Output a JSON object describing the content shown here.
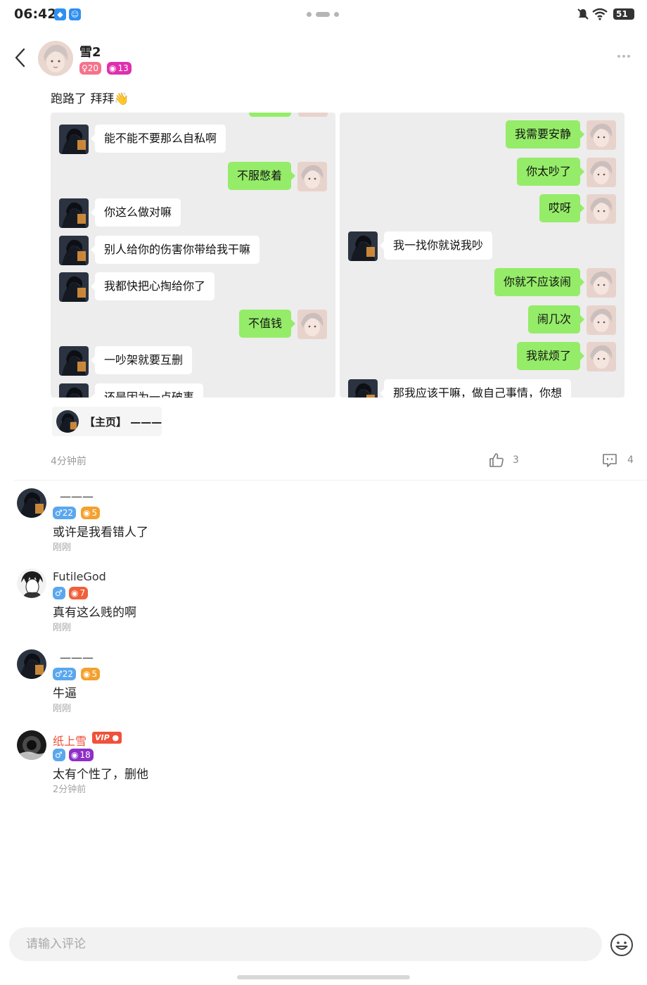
{
  "status_bar": {
    "time": "06:42",
    "battery": "51"
  },
  "header": {
    "user_name": "雪2",
    "gender_age_badge": "♀20",
    "level_badge": "13"
  },
  "post": {
    "text": "跑路了 拜拜👋",
    "left_screenshot": [
      {
        "side": "left",
        "text": "能不能不要那么自私啊"
      },
      {
        "side": "right",
        "text": "不服憋着"
      },
      {
        "side": "left",
        "text": "你这么做对嘛"
      },
      {
        "side": "left",
        "text": "别人给你的伤害你带给我干嘛"
      },
      {
        "side": "left",
        "text": "我都快把心掏给你了"
      },
      {
        "side": "right",
        "text": "不值钱"
      },
      {
        "side": "left",
        "text": "一吵架就要互删"
      },
      {
        "side": "left",
        "text": "还是因为一点破事"
      }
    ],
    "right_screenshot": [
      {
        "side": "right",
        "text": "我需要安静"
      },
      {
        "side": "right",
        "text": "你太吵了"
      },
      {
        "side": "right",
        "text": "哎呀"
      },
      {
        "side": "left",
        "text": "我一找你就说我吵"
      },
      {
        "side": "right",
        "text": "你就不应该闹"
      },
      {
        "side": "right",
        "text": "闹几次"
      },
      {
        "side": "right",
        "text": "我就烦了"
      },
      {
        "side": "left",
        "text": "那我应该干嘛，做自己事情，你想"
      }
    ],
    "home_chip": "【主页】 ———",
    "time": "4分钟前",
    "like_count": "3",
    "comment_count": "4"
  },
  "comments": [
    {
      "name": "———",
      "gender_badge": "♂22",
      "level_badge": "5",
      "text": "或许是我看错人了",
      "time": "刚刚"
    },
    {
      "name": "FutileGod",
      "gender_badge": "♂",
      "level_badge": "7",
      "text": "真有这么贱的啊",
      "time": "刚刚"
    },
    {
      "name": "———",
      "gender_badge": "♂22",
      "level_badge": "5",
      "text": "牛逼",
      "time": "刚刚"
    },
    {
      "name": "纸上雪",
      "vip_label": "VIP",
      "gender_badge": "♂",
      "level_badge": "18",
      "text": "太有个性了，删他",
      "time": "2分钟前"
    }
  ],
  "input": {
    "placeholder": "请输入评论"
  },
  "colors": {
    "bubble_green": "#95ec69",
    "female_badge": "#f4728c",
    "male_badge": "#5aa7ee",
    "level_pink": "#e02fae",
    "level_orange": "#f3a12e",
    "level_red": "#f0603a",
    "level_purple": "#8d2fc8",
    "vip_red": "#f0513b"
  }
}
